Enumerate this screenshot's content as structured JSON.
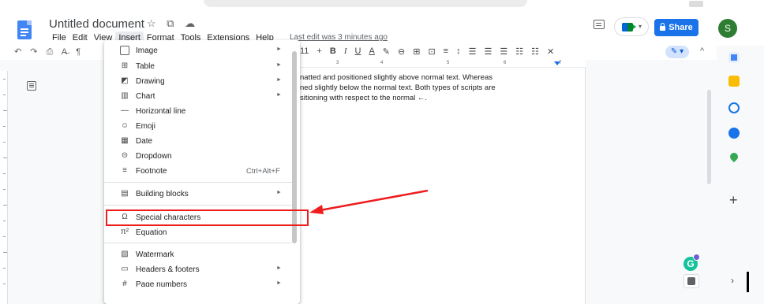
{
  "document": {
    "title": "Untitled document",
    "title_icons": "☆ ⧉ ☁",
    "last_edit": "Last edit was 3 minutes ago"
  },
  "menubar": [
    "File",
    "Edit",
    "View",
    "Insert",
    "Format",
    "Tools",
    "Extensions",
    "Help"
  ],
  "share_label": "Share",
  "avatar_letter": "S",
  "toolbar": {
    "left_icons": "↶ ↷ ⎙ A̶ ¶",
    "font_size": "11",
    "right_items": [
      "+",
      "B",
      "I",
      "U",
      "A",
      "✎",
      "⊖",
      "⊞",
      "⊡",
      "≡",
      "↕",
      "☰",
      "☰",
      "☰",
      "☷",
      "☷",
      "✕"
    ],
    "pen": "✎ ▾",
    "collapse": "^"
  },
  "ruler": {
    "ticks": [
      "3",
      "4",
      "5",
      "6",
      "7"
    ]
  },
  "body_text": [
    "natted and positioned slightly above normal text. Whereas",
    "ned slightly below the normal text. Both types of scripts are",
    "sitioning with respect to the normal ←."
  ],
  "menu": {
    "items": [
      {
        "icon": "image-icon",
        "glyph": "▣",
        "label": "Image",
        "submenu": true
      },
      {
        "icon": "table-icon",
        "glyph": "⊞",
        "label": "Table",
        "submenu": true
      },
      {
        "icon": "drawing-icon",
        "glyph": "◩",
        "label": "Drawing",
        "submenu": true
      },
      {
        "icon": "chart-icon",
        "glyph": "▥",
        "label": "Chart",
        "submenu": true
      },
      {
        "icon": "horizontal-line-icon",
        "glyph": "—",
        "label": "Horizontal line",
        "submenu": false
      },
      {
        "icon": "emoji-icon",
        "glyph": "☺",
        "label": "Emoji",
        "submenu": false
      },
      {
        "icon": "date-icon",
        "glyph": "▦",
        "label": "Date",
        "submenu": false
      },
      {
        "icon": "dropdown-icon",
        "glyph": "⊝",
        "label": "Dropdown",
        "submenu": false
      },
      {
        "icon": "footnote-icon",
        "glyph": "≡",
        "label": "Footnote",
        "shortcut": "Ctrl+Alt+F",
        "submenu": false
      },
      {
        "icon": "building-blocks-icon",
        "glyph": "▤",
        "label": "Building blocks",
        "submenu": true
      },
      {
        "icon": "special-characters-icon",
        "glyph": "Ω",
        "label": "Special characters",
        "submenu": false
      },
      {
        "icon": "equation-icon",
        "glyph": "π²",
        "label": "Equation",
        "submenu": false
      },
      {
        "icon": "watermark-icon",
        "glyph": "▧",
        "label": "Watermark",
        "submenu": false
      },
      {
        "icon": "headers-footers-icon",
        "glyph": "▭",
        "label": "Headers & footers",
        "submenu": true
      },
      {
        "icon": "page-numbers-icon",
        "glyph": "#",
        "label": "Page numbers",
        "submenu": true
      }
    ],
    "submenu_arrow": "►"
  },
  "sidepanel": {
    "icons": [
      {
        "name": "calendar-icon",
        "color": "#1a73e8"
      },
      {
        "name": "keep-icon",
        "color": "#fbbc04"
      },
      {
        "name": "tasks-icon",
        "color": "#1a73e8"
      },
      {
        "name": "contacts-icon",
        "color": "#1a73e8"
      },
      {
        "name": "maps-icon",
        "color": "#34a853"
      }
    ],
    "plus": "+",
    "chevron": "›"
  },
  "grammarly_letter": "G",
  "colors": {
    "accent": "#1a73e8",
    "annotation_red": "#ee1c1c"
  }
}
